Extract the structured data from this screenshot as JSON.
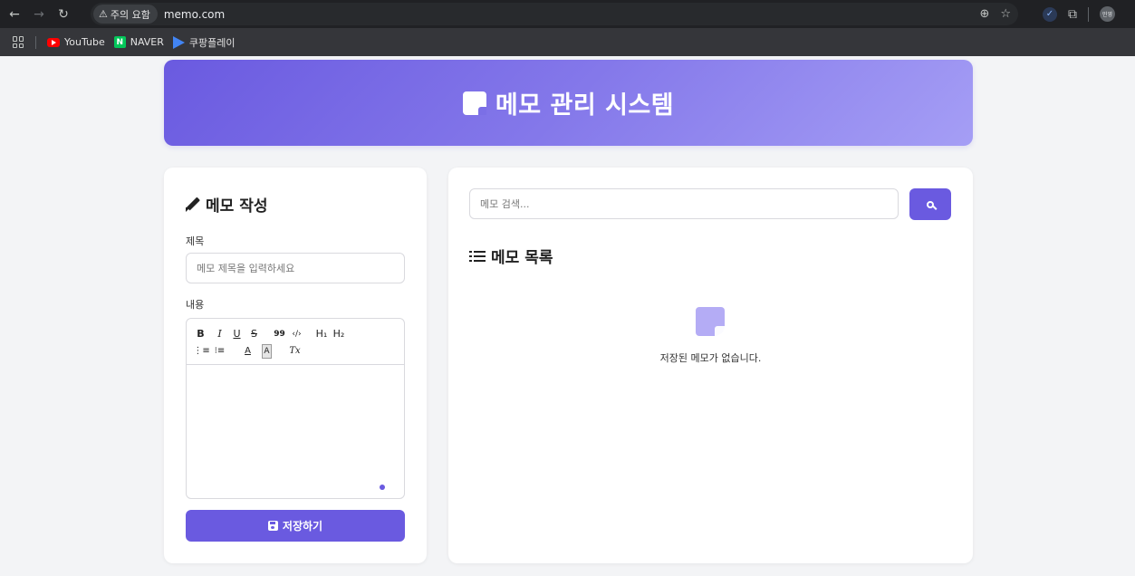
{
  "browser": {
    "security_chip": "주의 요함",
    "url": "memo.com",
    "profile_label": "민영",
    "bookmarks": [
      {
        "label": "YouTube"
      },
      {
        "label": "NAVER"
      },
      {
        "label": "쿠팡플레이"
      }
    ]
  },
  "header": {
    "title": "메모 관리 시스템"
  },
  "editor_panel": {
    "title": "메모 작성",
    "title_label": "제목",
    "title_placeholder": "메모 제목을 입력하세요",
    "content_label": "내용",
    "toolbar": {
      "bold": "B",
      "italic": "I",
      "underline": "U",
      "strike": "S",
      "quote": "99",
      "code": "‹/›",
      "h1": "H₁",
      "h2": "H₂",
      "ordered_list": "⋮≡",
      "bullet_list": "⁝≡",
      "text_color": "A",
      "bg_color": "A",
      "clear_format": "Tx"
    },
    "save_label": "저장하기"
  },
  "list_panel": {
    "search_placeholder": "메모 검색...",
    "title": "메모 목록",
    "empty_message": "저장된 메모가 없습니다."
  }
}
